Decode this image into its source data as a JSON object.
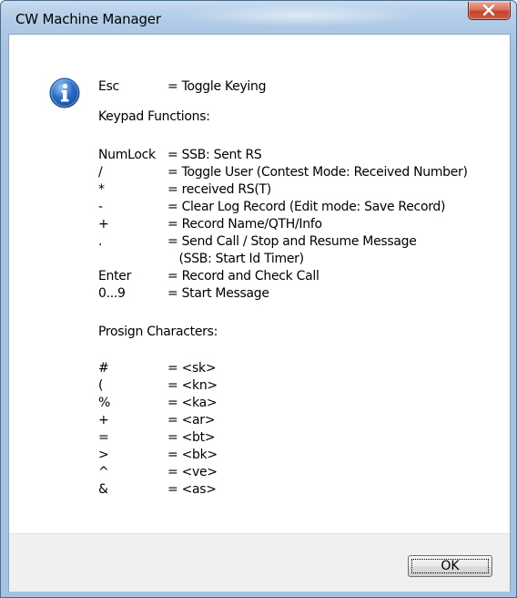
{
  "window": {
    "title": "CW Machine Manager"
  },
  "icons": {
    "info": "info-icon",
    "close": "close-icon"
  },
  "message": {
    "esc_row": {
      "key": "Esc",
      "desc": "= Toggle Keying"
    },
    "keypad_heading": "Keypad Functions:",
    "keypad_rows": [
      {
        "key": "NumLock",
        "desc": "= SSB: Sent RS"
      },
      {
        "key": "/",
        "desc": "= Toggle User (Contest Mode: Received Number)"
      },
      {
        "key": "*",
        "desc": "= received RS(T)"
      },
      {
        "key": "-",
        "desc": "= Clear Log Record (Edit mode: Save Record)"
      },
      {
        "key": "+",
        "desc": "= Record Name/QTH/Info"
      },
      {
        "key": ".",
        "desc": "= Send Call / Stop and Resume Message"
      },
      {
        "key": "",
        "desc": "   (SSB: Start Id Timer)"
      },
      {
        "key": "Enter",
        "desc": "= Record and Check Call"
      },
      {
        "key": "0...9",
        "desc": "= Start Message"
      }
    ],
    "prosign_heading": "Prosign Characters:",
    "prosign_rows": [
      {
        "key": "#",
        "desc": "= <sk>"
      },
      {
        "key": "(",
        "desc": "= <kn>"
      },
      {
        "key": "%",
        "desc": "= <ka>"
      },
      {
        "key": "+",
        "desc": "= <ar>"
      },
      {
        "key": "=",
        "desc": "= <bt>"
      },
      {
        "key": ">",
        "desc": "= <bk>"
      },
      {
        "key": "^",
        "desc": "= <ve>"
      },
      {
        "key": "&",
        "desc": "= <as>"
      }
    ]
  },
  "buttons": {
    "ok_label": "OK"
  },
  "colors": {
    "title_bar": "#b9d1ea",
    "close_button": "#c4442c",
    "info_icon": "#2a6fc9",
    "footer": "#f0f0f0"
  }
}
